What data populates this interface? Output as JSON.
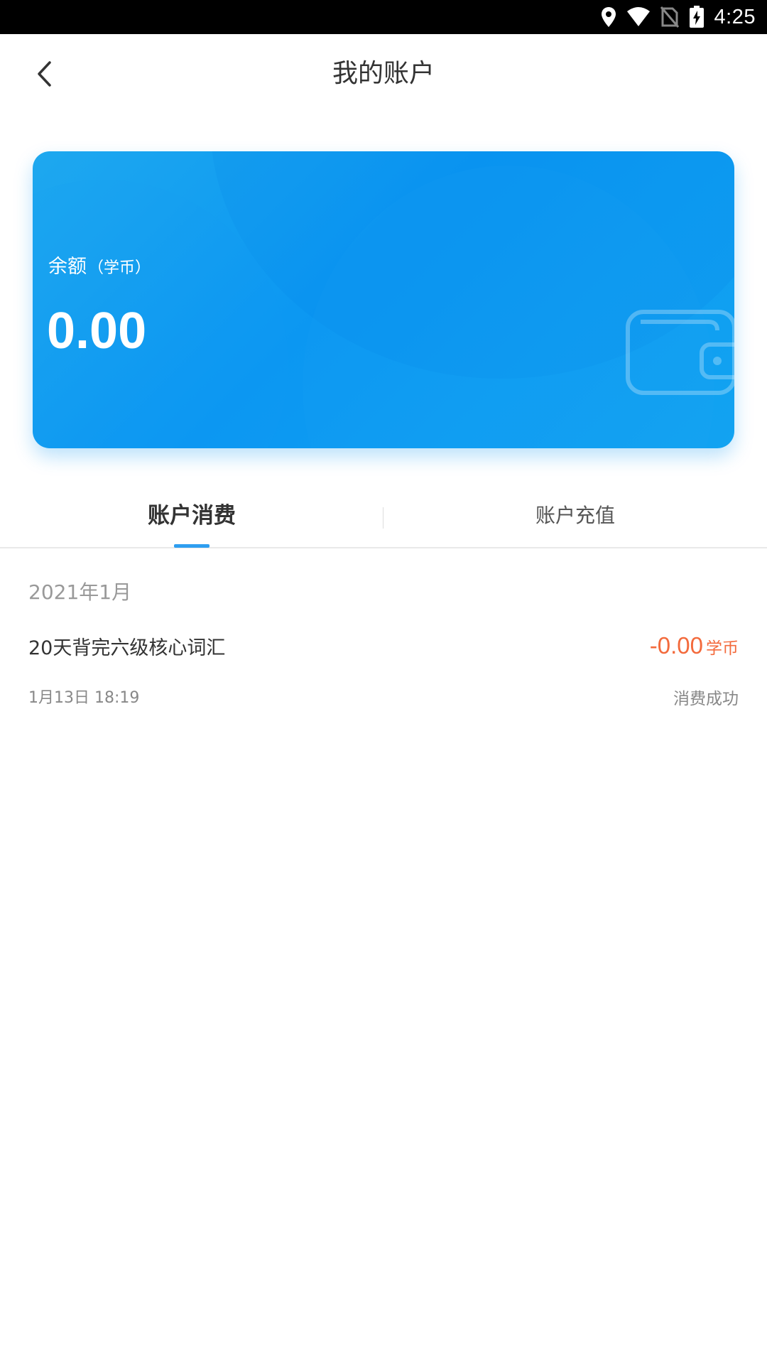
{
  "status_bar": {
    "time": "4:25",
    "icons": [
      "location-icon",
      "wifi-icon",
      "no-sim-icon",
      "battery-charging-icon"
    ]
  },
  "header": {
    "title": "我的账户",
    "back_icon": "chevron-left-icon"
  },
  "balance_card": {
    "label": "余额",
    "unit": "（学币）",
    "value": "0.00",
    "decor_icon": "wallet-icon",
    "colors": {
      "start": "#1ea8ef",
      "end": "#0b97f2"
    }
  },
  "tabs": [
    {
      "label": "账户消费",
      "active": true
    },
    {
      "label": "账户充值",
      "active": false
    }
  ],
  "records": {
    "month": "2021年1月",
    "items": [
      {
        "title": "20天背完六级核心词汇",
        "time": "1月13日 18:19",
        "amount": "-0.00",
        "unit": "学币",
        "status": "消费成功"
      }
    ]
  },
  "colors": {
    "accent": "#2e9ef0",
    "amount": "#f36a3c"
  }
}
